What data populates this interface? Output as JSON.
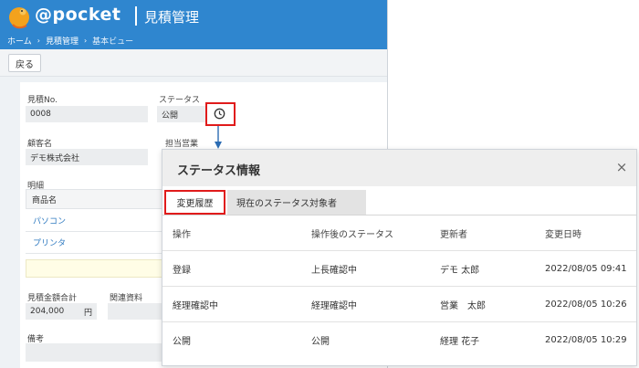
{
  "app": {
    "logo_text": "@pocket",
    "title": "見積管理",
    "breadcrumb": [
      "ホーム",
      "見積管理",
      "基本ビュー"
    ],
    "back_label": "戻る"
  },
  "form": {
    "quote_no_label": "見積No.",
    "quote_no_value": "0008",
    "status_label": "ステータス",
    "status_value": "公開",
    "customer_label": "顧客名",
    "customer_value": "デモ株式会社",
    "sales_label": "担当営業",
    "details_label": "明細",
    "product_header": "商品名",
    "products": [
      "パソコン",
      "プリンタ"
    ],
    "total_label": "見積金額合計",
    "total_value": "204,000",
    "total_unit": "円",
    "related_label": "関連資料",
    "notes_label": "備考"
  },
  "modal": {
    "title": "ステータス情報",
    "close_glyph": "×",
    "tabs": [
      "変更履歴",
      "現在のステータス対象者"
    ],
    "columns": [
      "操作",
      "操作後のステータス",
      "更新者",
      "変更日時"
    ],
    "rows": [
      [
        "登録",
        "上長確認中",
        "デモ 太郎",
        "2022/08/05 09:41"
      ],
      [
        "経理確認中",
        "経理確認中",
        "営業　太郎",
        "2022/08/05 10:26"
      ],
      [
        "公開",
        "公開",
        "経理 花子",
        "2022/08/05 10:29"
      ]
    ]
  },
  "colors": {
    "header_blue": "#2f86cf",
    "highlight_red": "#e01b1b",
    "link_blue": "#2f7ac0",
    "arrow_blue": "#2b6cb3"
  },
  "icons": [
    "kangaroo-logo-icon",
    "clock-icon",
    "close-icon",
    "arrow-down-icon"
  ]
}
